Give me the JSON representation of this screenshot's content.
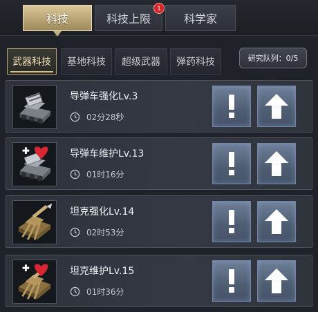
{
  "top_tabs": [
    {
      "label": "科技",
      "active": true
    },
    {
      "label": "科技上限",
      "badge": "1"
    },
    {
      "label": "科学家"
    }
  ],
  "sub_tabs": [
    {
      "label": "武器科技",
      "active": true
    },
    {
      "label": "基地科技"
    },
    {
      "label": "超级武器"
    },
    {
      "label": "弹药科技"
    }
  ],
  "queue": {
    "label": "研究队列：0/5"
  },
  "rows": [
    {
      "title": "导弹车强化Lv.3",
      "time": "02分28秒",
      "icon": "missile-truck-icon"
    },
    {
      "title": "导弹车维护Lv.13",
      "time": "01时16分",
      "icon": "missile-truck-repair-icon"
    },
    {
      "title": "坦克强化Lv.14",
      "time": "02时53分",
      "icon": "tank-icon"
    },
    {
      "title": "坦克维护Lv.15",
      "time": "01时36分",
      "icon": "tank-repair-icon"
    }
  ],
  "colors": {
    "active_tab": "#c2ae7e",
    "button_blue": "#5a6a82",
    "badge_red": "#d7232a",
    "heart_red": "#d92632"
  }
}
